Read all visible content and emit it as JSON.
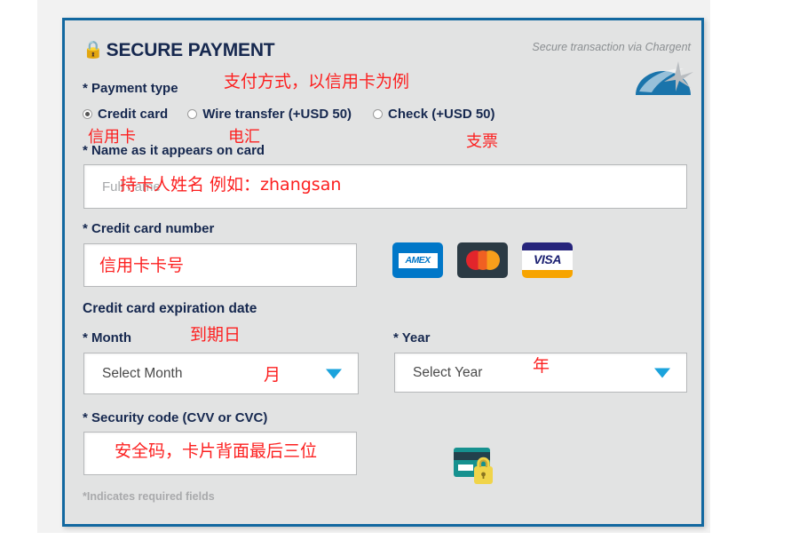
{
  "card": {
    "header": {
      "lock_icon": "lock-icon",
      "title": "SECURE PAYMENT",
      "secure_note": "Secure transaction via Chargent",
      "logo_icon": "chargent-dome-star-logo"
    },
    "payment_type": {
      "label": "* Payment type",
      "options": [
        {
          "label": "Credit card",
          "selected": true
        },
        {
          "label": "Wire transfer (+USD 50)",
          "selected": false
        },
        {
          "label": "Check (+USD 50)",
          "selected": false
        }
      ]
    },
    "name_field": {
      "label": "* Name as it appears on card",
      "placeholder": "Full name",
      "value": ""
    },
    "card_number_field": {
      "label": "* Credit card number",
      "placeholder": "",
      "value": ""
    },
    "brands": [
      {
        "name": "amex-logo",
        "text": "AMEX"
      },
      {
        "name": "mastercard-logo",
        "text": ""
      },
      {
        "name": "visa-logo",
        "text": "VISA"
      }
    ],
    "expiration": {
      "section_label": "Credit card expiration date",
      "month": {
        "label": "* Month",
        "selected": "Select Month"
      },
      "year": {
        "label": "* Year",
        "selected": "Select Year"
      }
    },
    "security_code": {
      "label": "* Security code (CVV or CVC)",
      "placeholder": "",
      "value": "",
      "icon": "credit-card-lock-icon"
    },
    "footnote": "*Indicates required fields"
  },
  "annotations": [
    {
      "id": "payment-type",
      "text": "支付方式，以信用卡为例"
    },
    {
      "id": "credit-card",
      "text": "信用卡"
    },
    {
      "id": "wire-transfer",
      "text": "电汇"
    },
    {
      "id": "check",
      "text": "支票"
    },
    {
      "id": "cardholder-name",
      "text": "持卡人姓名 例如：zhangsan"
    },
    {
      "id": "card-number",
      "text": "信用卡卡号"
    },
    {
      "id": "expiry",
      "text": "到期日"
    },
    {
      "id": "month",
      "text": "月"
    },
    {
      "id": "year",
      "text": "年"
    },
    {
      "id": "cvv",
      "text": "安全码，卡片背面最后三位"
    }
  ],
  "colors": {
    "card_border": "#1268a0",
    "card_bg": "#e2e3e3",
    "label_navy": "#16284f",
    "annotation_red": "#fc2020",
    "arrow_blue": "#1ba3dc"
  }
}
